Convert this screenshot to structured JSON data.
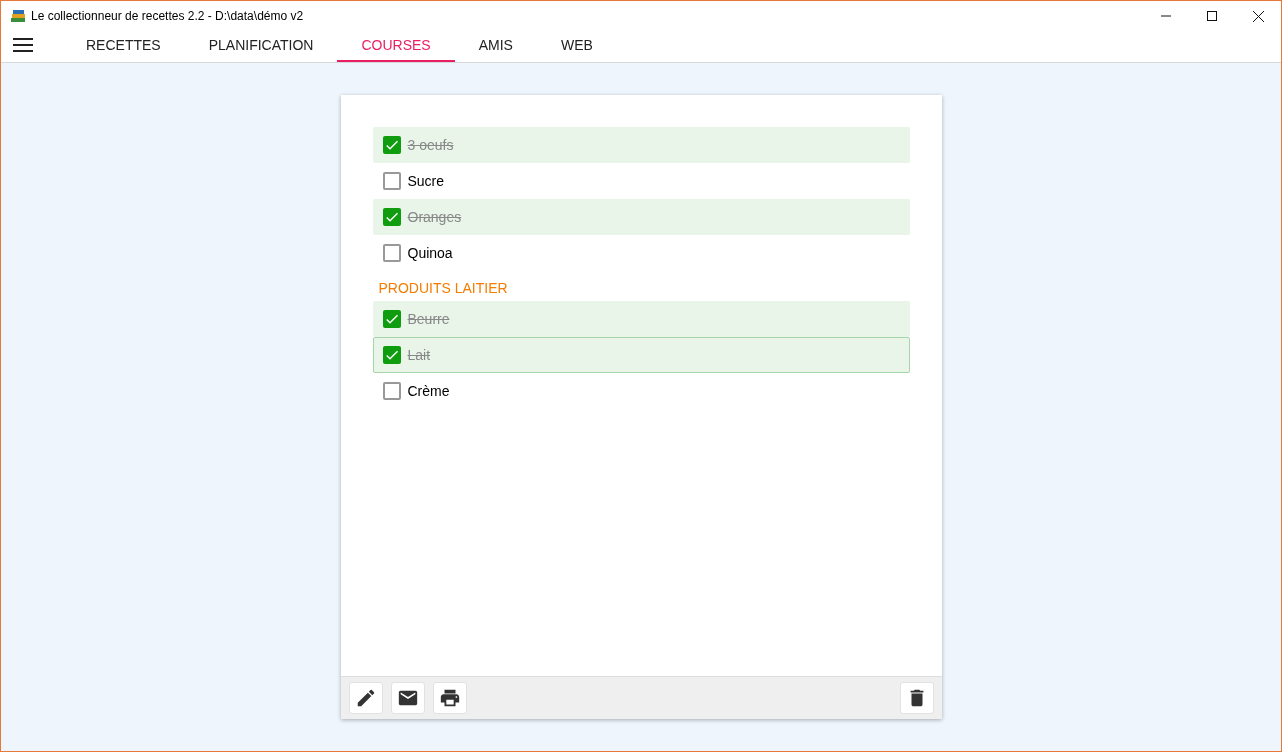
{
  "window": {
    "title": "Le collectionneur de recettes 2.2 - D:\\data\\démo v2"
  },
  "tabs": [
    {
      "label": "RECETTES",
      "selected": false
    },
    {
      "label": "PLANIFICATION",
      "selected": false
    },
    {
      "label": "COURSES",
      "selected": true
    },
    {
      "label": "AMIS",
      "selected": false
    },
    {
      "label": "WEB",
      "selected": false
    }
  ],
  "list": [
    {
      "kind": "item",
      "label": "3 oeufs",
      "checked": true,
      "focused": false
    },
    {
      "kind": "item",
      "label": "Sucre",
      "checked": false,
      "focused": false
    },
    {
      "kind": "item",
      "label": "Oranges",
      "checked": true,
      "focused": false
    },
    {
      "kind": "item",
      "label": "Quinoa",
      "checked": false,
      "focused": false
    },
    {
      "kind": "heading",
      "label": "PRODUITS LAITIER"
    },
    {
      "kind": "item",
      "label": "Beurre",
      "checked": true,
      "focused": false
    },
    {
      "kind": "item",
      "label": "Lait",
      "checked": true,
      "focused": true
    },
    {
      "kind": "item",
      "label": "Crème",
      "checked": false,
      "focused": false
    }
  ]
}
